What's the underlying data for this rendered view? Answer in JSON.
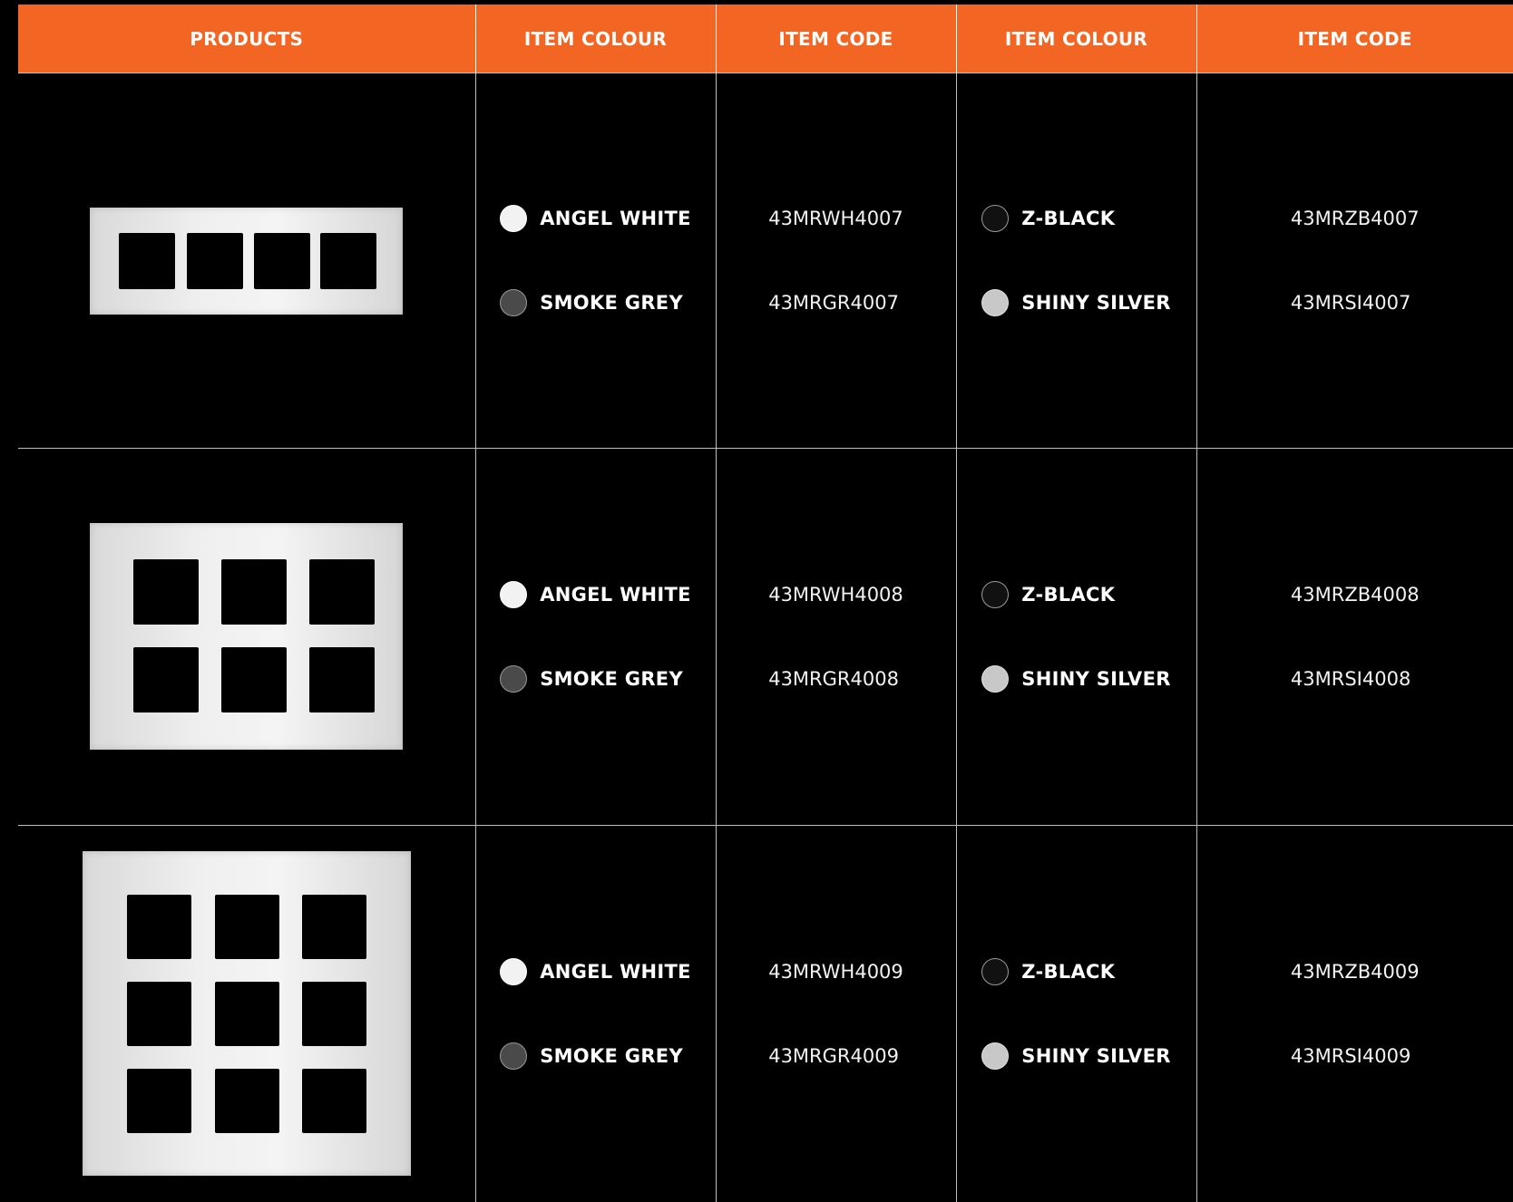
{
  "headers": [
    "PRODUCTS",
    "ITEM COLOUR",
    "ITEM CODE",
    "ITEM COLOUR",
    "ITEM CODE"
  ],
  "colors": {
    "header_bg": "#f26522",
    "page_bg": "#000000",
    "text": "#ffffff",
    "angel_white": "#f2f2f2",
    "smoke_grey": "#4a4a4a",
    "z_black": "#111111",
    "shiny_silver": "#c8c8c8"
  },
  "rows": [
    {
      "product_icon": "4-module-plate-icon",
      "colour_a": [
        {
          "name": "ANGEL WHITE",
          "dot": "#f2f2f2"
        },
        {
          "name": "SMOKE GREY",
          "dot": "#4a4a4a"
        }
      ],
      "code_a": [
        "43MRWH4007",
        "43MRGR4007"
      ],
      "colour_b": [
        {
          "name": "Z-BLACK",
          "dot": "#111111"
        },
        {
          "name": "SHINY SILVER",
          "dot": "#c8c8c8"
        }
      ],
      "code_b": [
        "43MRZB4007",
        "43MRSI4007"
      ]
    },
    {
      "product_icon": "6-module-plate-icon",
      "colour_a": [
        {
          "name": "ANGEL WHITE",
          "dot": "#f2f2f2"
        },
        {
          "name": "SMOKE GREY",
          "dot": "#4a4a4a"
        }
      ],
      "code_a": [
        "43MRWH4008",
        "43MRGR4008"
      ],
      "colour_b": [
        {
          "name": "Z-BLACK",
          "dot": "#111111"
        },
        {
          "name": "SHINY SILVER",
          "dot": "#c8c8c8"
        }
      ],
      "code_b": [
        "43MRZB4008",
        "43MRSI4008"
      ]
    },
    {
      "product_icon": "9-module-plate-icon",
      "colour_a": [
        {
          "name": "ANGEL WHITE",
          "dot": "#f2f2f2"
        },
        {
          "name": "SMOKE GREY",
          "dot": "#4a4a4a"
        }
      ],
      "code_a": [
        "43MRWH4009",
        "43MRGR4009"
      ],
      "colour_b": [
        {
          "name": "Z-BLACK",
          "dot": "#111111"
        },
        {
          "name": "SHINY SILVER",
          "dot": "#c8c8c8"
        }
      ],
      "code_b": [
        "43MRZB4009",
        "43MRSI4009"
      ]
    }
  ]
}
